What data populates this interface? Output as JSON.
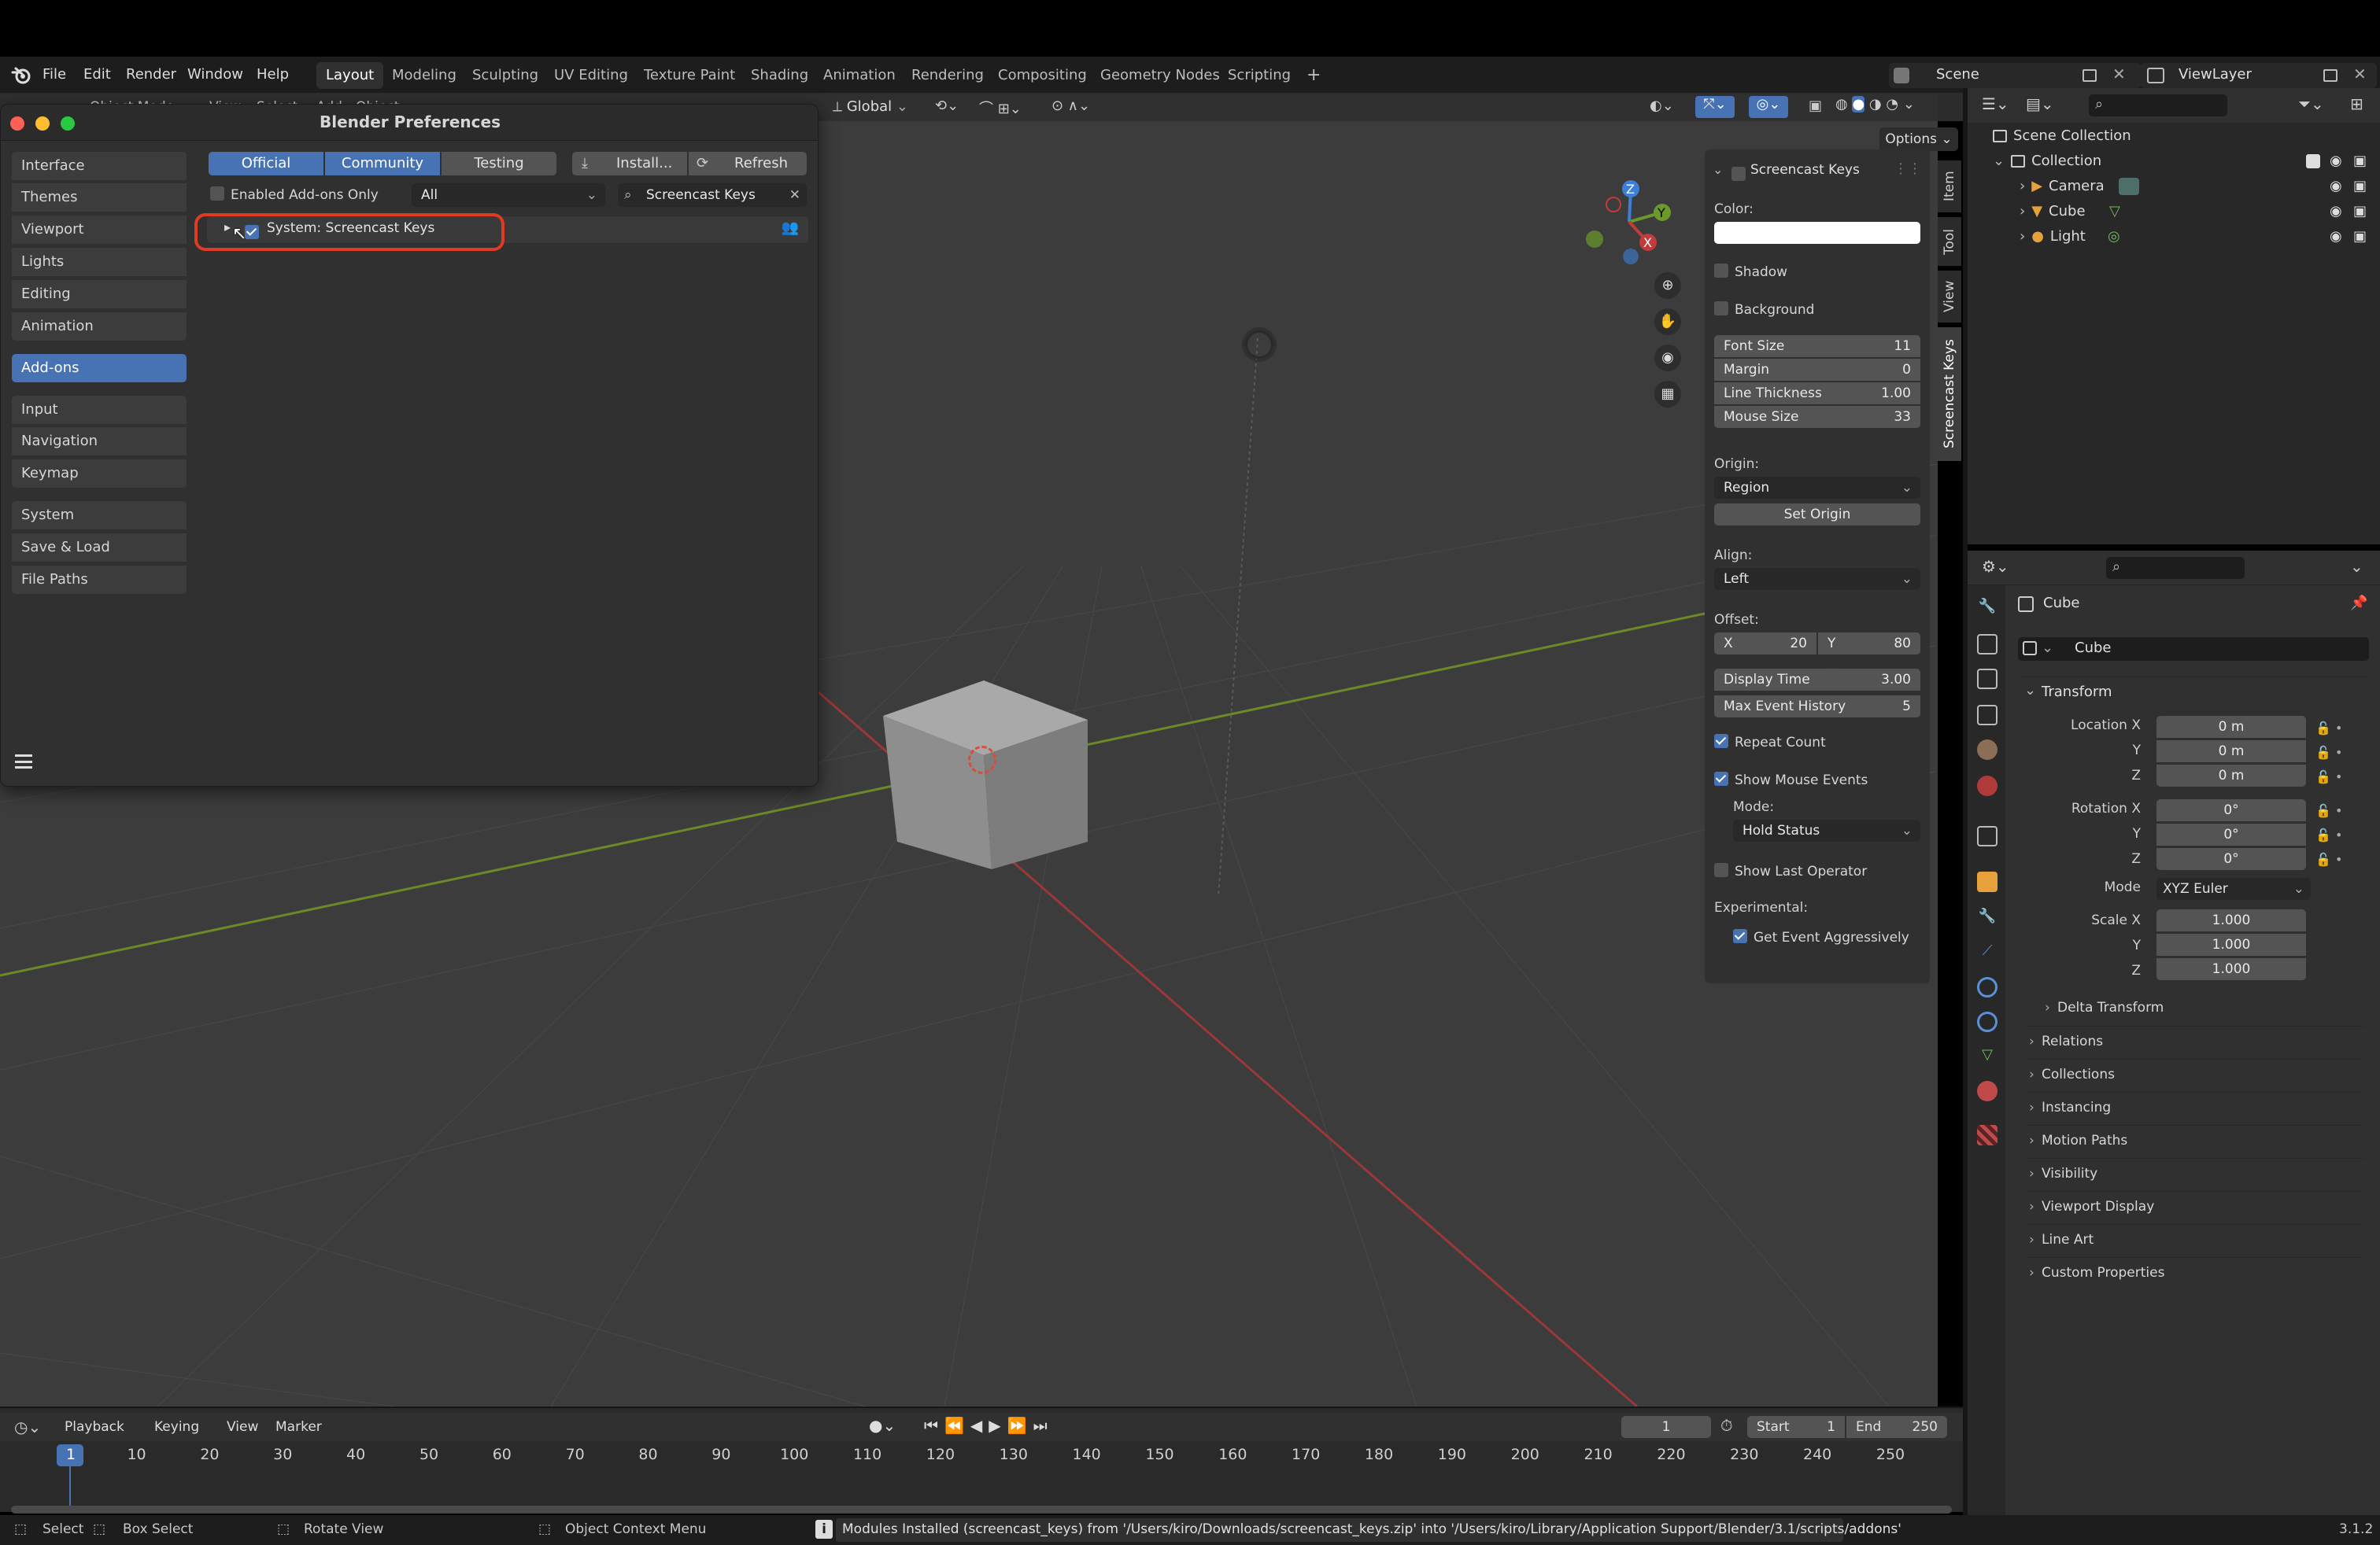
{
  "menubar": {
    "items": [
      "File",
      "Edit",
      "Render",
      "Window",
      "Help"
    ],
    "workspaces": [
      "Layout",
      "Modeling",
      "Sculpting",
      "UV Editing",
      "Texture Paint",
      "Shading",
      "Animation",
      "Rendering",
      "Compositing",
      "Geometry Nodes",
      "Scripting"
    ],
    "add_tab": "+",
    "scene": "Scene",
    "view_layer": "ViewLayer"
  },
  "viewport_header": {
    "mode": "Object Mode",
    "menus": [
      "View",
      "Select",
      "Add",
      "Object"
    ],
    "orientation": "Global",
    "options": "Options"
  },
  "preferences": {
    "title": "Blender Preferences",
    "nav": [
      "Interface",
      "Themes",
      "Viewport",
      "Lights",
      "Editing",
      "Animation",
      "Add-ons",
      "Input",
      "Navigation",
      "Keymap",
      "System",
      "Save & Load",
      "File Paths"
    ],
    "active_nav": "Add-ons",
    "support_tabs": [
      "Official",
      "Community",
      "Testing"
    ],
    "install_label": "Install...",
    "refresh_label": "Refresh",
    "enabled_only_label": "Enabled Add-ons Only",
    "category_value": "All",
    "search_value": "Screencast Keys",
    "addon_name": "System: Screencast Keys",
    "addon_enabled": true
  },
  "npanel": {
    "title": "Screencast Keys",
    "color_label": "Color:",
    "shadow_label": "Shadow",
    "background_label": "Background",
    "font_size": {
      "label": "Font Size",
      "value": "11"
    },
    "margin": {
      "label": "Margin",
      "value": "0"
    },
    "line_thickness": {
      "label": "Line Thickness",
      "value": "1.00"
    },
    "mouse_size": {
      "label": "Mouse Size",
      "value": "33"
    },
    "origin_label": "Origin:",
    "origin_value": "Region",
    "set_origin": "Set Origin",
    "align_label": "Align:",
    "align_value": "Left",
    "offset_label": "Offset:",
    "offset_x_label": "X",
    "offset_x": "20",
    "offset_y_label": "Y",
    "offset_y": "80",
    "display_time": {
      "label": "Display Time",
      "value": "3.00"
    },
    "max_event_history": {
      "label": "Max Event History",
      "value": "5"
    },
    "repeat_count": "Repeat Count",
    "show_mouse_events": "Show Mouse Events",
    "mode_label": "Mode:",
    "mode_value": "Hold Status",
    "show_last_operator": "Show Last Operator",
    "experimental_label": "Experimental:",
    "get_event_aggressively": "Get Event Aggressively",
    "side_tabs": [
      "Item",
      "Tool",
      "View",
      "Screencast Keys"
    ]
  },
  "outliner": {
    "root": "Scene Collection",
    "collection": "Collection",
    "items": [
      "Camera",
      "Cube",
      "Light"
    ]
  },
  "properties": {
    "object_name": "Cube",
    "data_name": "Cube",
    "transform_label": "Transform",
    "location_label": "Location X",
    "location": [
      "0 m",
      "0 m",
      "0 m"
    ],
    "rotation_label": "Rotation X",
    "rotation": [
      "0°",
      "0°",
      "0°"
    ],
    "mode_label": "Mode",
    "mode_value": "XYZ Euler",
    "scale_label": "Scale X",
    "scale": [
      "1.000",
      "1.000",
      "1.000"
    ],
    "axis_y": "Y",
    "axis_z": "Z",
    "sections": [
      "Delta Transform",
      "Relations",
      "Collections",
      "Instancing",
      "Motion Paths",
      "Visibility",
      "Viewport Display",
      "Line Art",
      "Custom Properties"
    ]
  },
  "timeline": {
    "menus": [
      "Playback",
      "Keying",
      "View",
      "Marker"
    ],
    "current_frame": "1",
    "start_label": "Start",
    "start": "1",
    "end_label": "End",
    "end": "250",
    "ticks": [
      "1",
      "10",
      "20",
      "30",
      "40",
      "50",
      "60",
      "70",
      "80",
      "90",
      "100",
      "110",
      "120",
      "130",
      "140",
      "150",
      "160",
      "170",
      "180",
      "190",
      "200",
      "210",
      "220",
      "230",
      "240",
      "250"
    ]
  },
  "statusbar": {
    "select": "Select",
    "box_select": "Box Select",
    "rotate_view": "Rotate View",
    "context_menu": "Object Context Menu",
    "message": "Modules Installed (screencast_keys) from '/Users/kiro/Downloads/screencast_keys.zip' into '/Users/kiro/Library/Application Support/Blender/3.1/scripts/addons'",
    "version": "3.1.2"
  },
  "colors": {
    "accent": "#4772b3",
    "highlight_ring": "#e03a22",
    "axis_x": "#a83a3a",
    "axis_y": "#7c9a2a"
  }
}
